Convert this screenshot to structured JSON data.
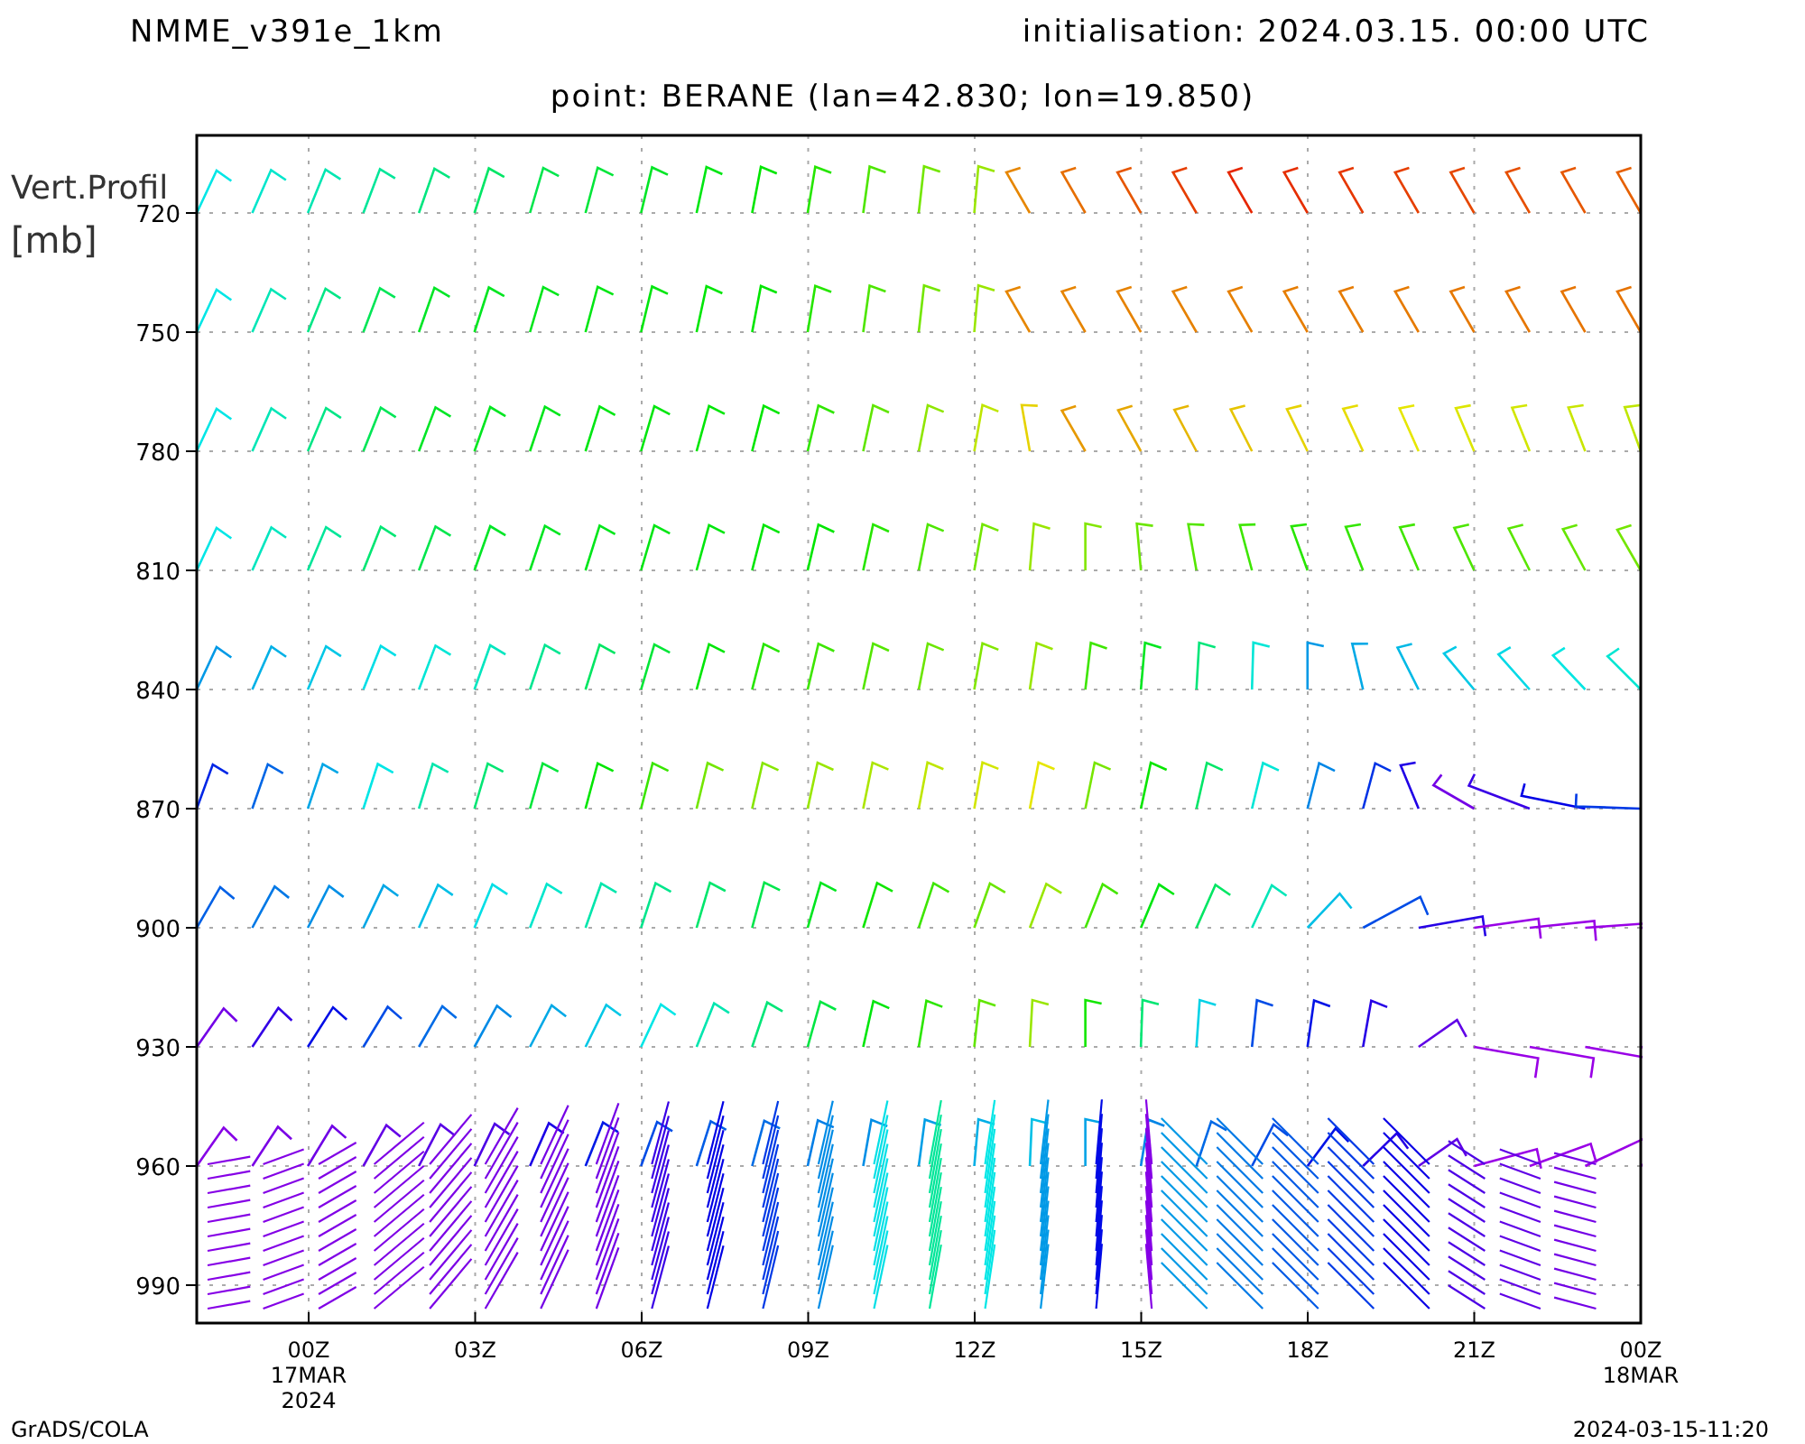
{
  "header": {
    "model": "NMME_v391e_1km",
    "initialisation": "initialisation: 2024.03.15. 00:00 UTC"
  },
  "subtitle": "point: BERANE (lan=42.830; lon=19.850)",
  "y_axis": {
    "title": "Vert.Profil",
    "unit": "[mb]",
    "ticks": [
      "720",
      "750",
      "780",
      "810",
      "840",
      "870",
      "900",
      "930",
      "960",
      "990"
    ]
  },
  "x_axis": {
    "ticks": [
      {
        "lines": [
          "00Z",
          "17MAR",
          "2024"
        ]
      },
      {
        "lines": [
          "03Z"
        ]
      },
      {
        "lines": [
          "06Z"
        ]
      },
      {
        "lines": [
          "09Z"
        ]
      },
      {
        "lines": [
          "12Z"
        ]
      },
      {
        "lines": [
          "15Z"
        ]
      },
      {
        "lines": [
          "18Z"
        ]
      },
      {
        "lines": [
          "21Z"
        ]
      },
      {
        "lines": [
          "00Z",
          "18MAR"
        ]
      }
    ]
  },
  "footer": {
    "left": "GrADS/COLA",
    "right": "2024-03-15-11:20"
  }
}
